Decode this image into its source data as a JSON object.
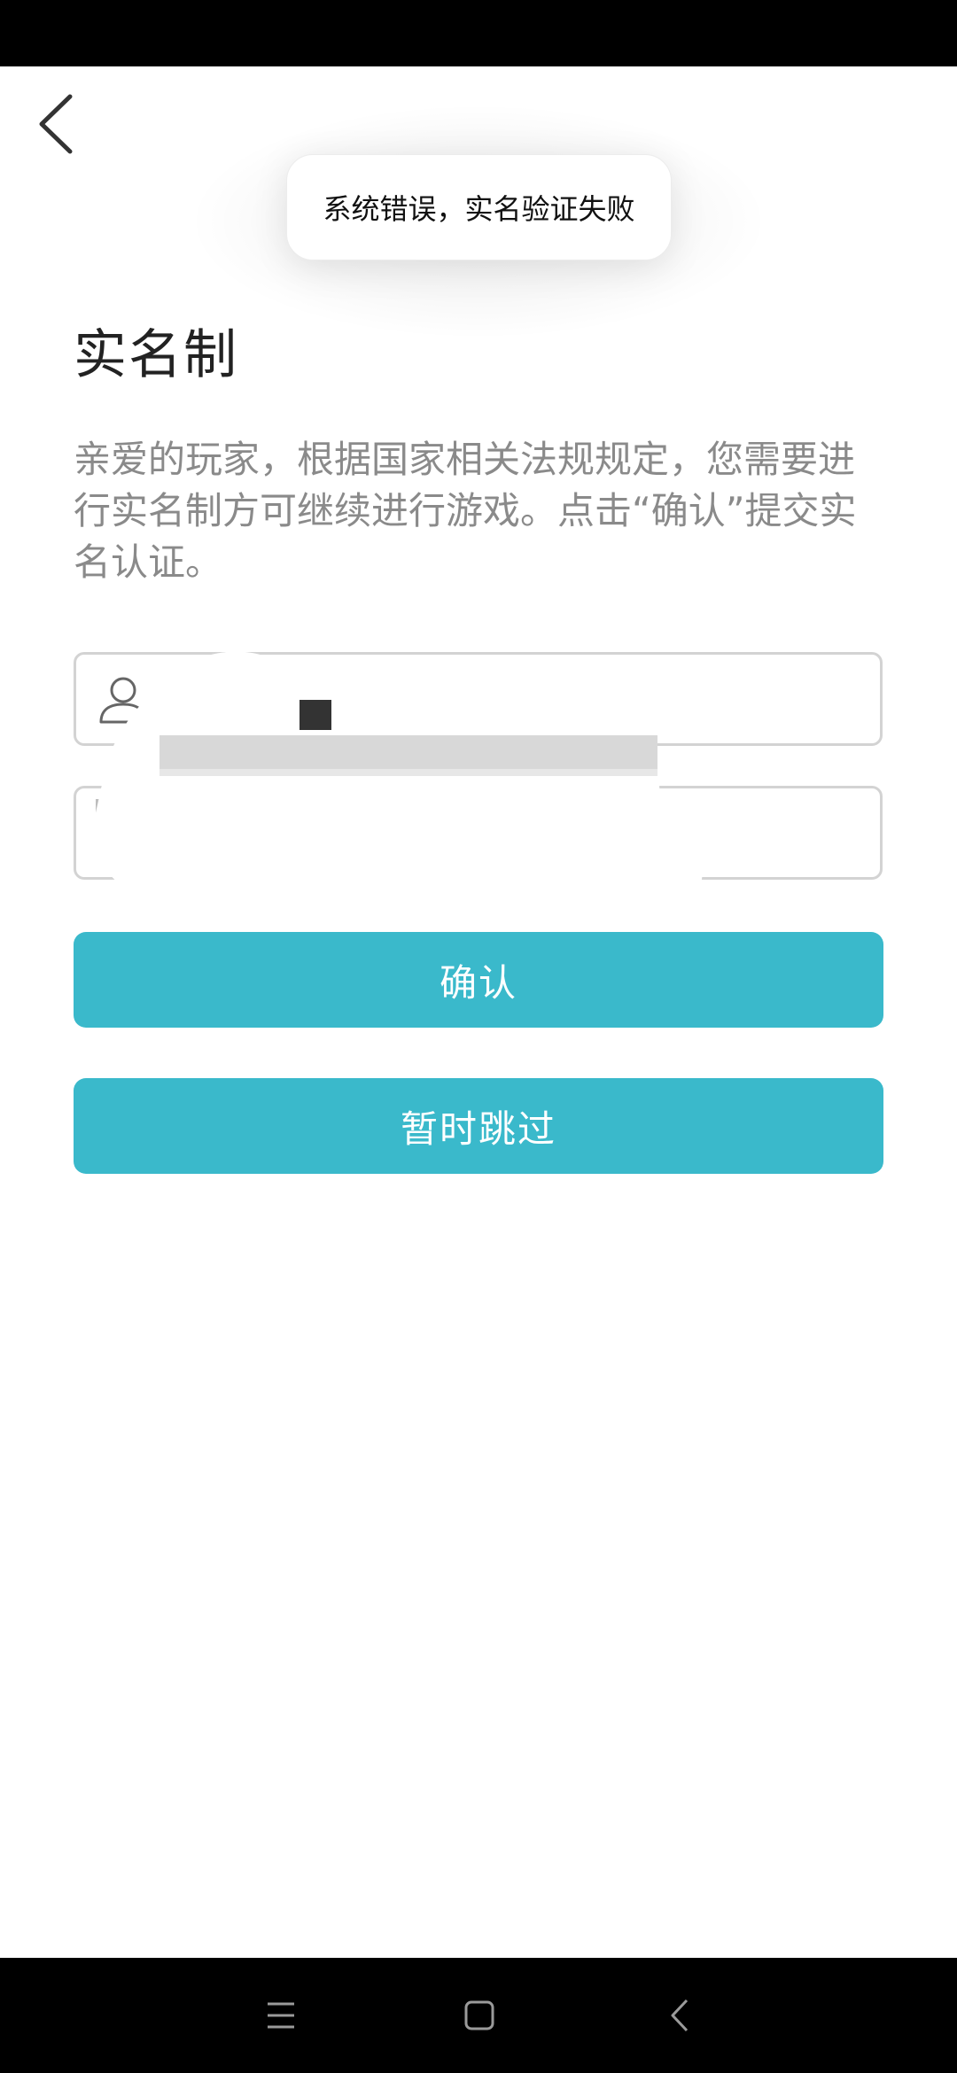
{
  "toast": {
    "message": "系统错误，实名验证失败"
  },
  "page": {
    "title": "实名制",
    "intro": "亲爱的玩家，根据国家相关法规规定，您需要进行实名制方可继续进行游戏。点击“确认”提交实名认证。"
  },
  "form": {
    "name_icon": "user-icon",
    "name_value_status": "redacted",
    "id_value_status": "redacted"
  },
  "buttons": {
    "confirm_label": "确认",
    "skip_label": "暂时跳过",
    "color": "#3ab9cb"
  },
  "icons": {
    "back": "back-arrow-icon",
    "nav_menu": "menu-icon",
    "nav_home": "home-icon",
    "nav_back": "back-icon"
  }
}
